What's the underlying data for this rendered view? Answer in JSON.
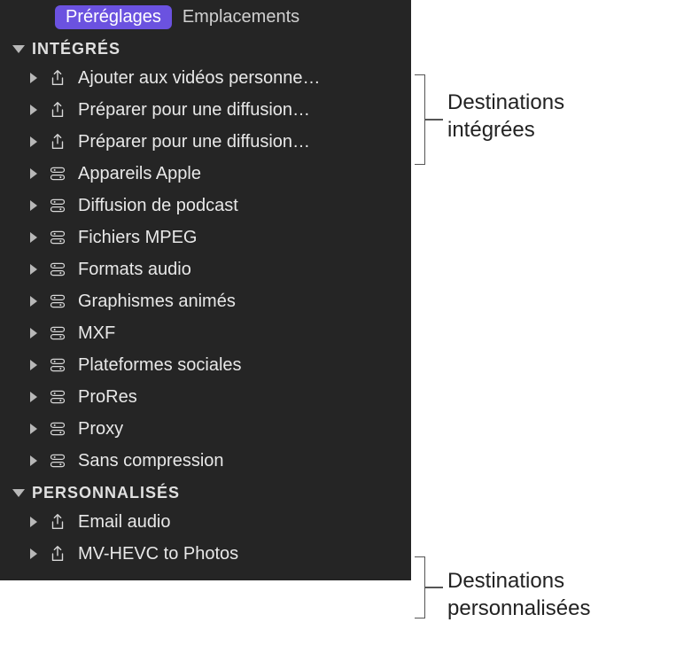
{
  "tabs": {
    "presets": "Préréglages",
    "locations": "Emplacements"
  },
  "sections": {
    "builtin": {
      "title": "INTÉGRÉS",
      "items": [
        {
          "label": "Ajouter aux vidéos personne…",
          "icon": "share"
        },
        {
          "label": "Préparer pour une diffusion…",
          "icon": "share"
        },
        {
          "label": "Préparer pour une diffusion…",
          "icon": "share"
        },
        {
          "label": "Appareils Apple",
          "icon": "preset"
        },
        {
          "label": "Diffusion de podcast",
          "icon": "preset"
        },
        {
          "label": "Fichiers MPEG",
          "icon": "preset"
        },
        {
          "label": "Formats audio",
          "icon": "preset"
        },
        {
          "label": "Graphismes animés",
          "icon": "preset"
        },
        {
          "label": "MXF",
          "icon": "preset"
        },
        {
          "label": "Plateformes sociales",
          "icon": "preset"
        },
        {
          "label": "ProRes",
          "icon": "preset"
        },
        {
          "label": "Proxy",
          "icon": "preset"
        },
        {
          "label": "Sans compression",
          "icon": "preset"
        }
      ]
    },
    "custom": {
      "title": "PERSONNALISÉS",
      "items": [
        {
          "label": "Email audio",
          "icon": "share"
        },
        {
          "label": "MV-HEVC to Photos",
          "icon": "share"
        }
      ]
    }
  },
  "annotations": {
    "builtin": "Destinations\nintégrées",
    "custom": "Destinations\npersonnalisées"
  }
}
